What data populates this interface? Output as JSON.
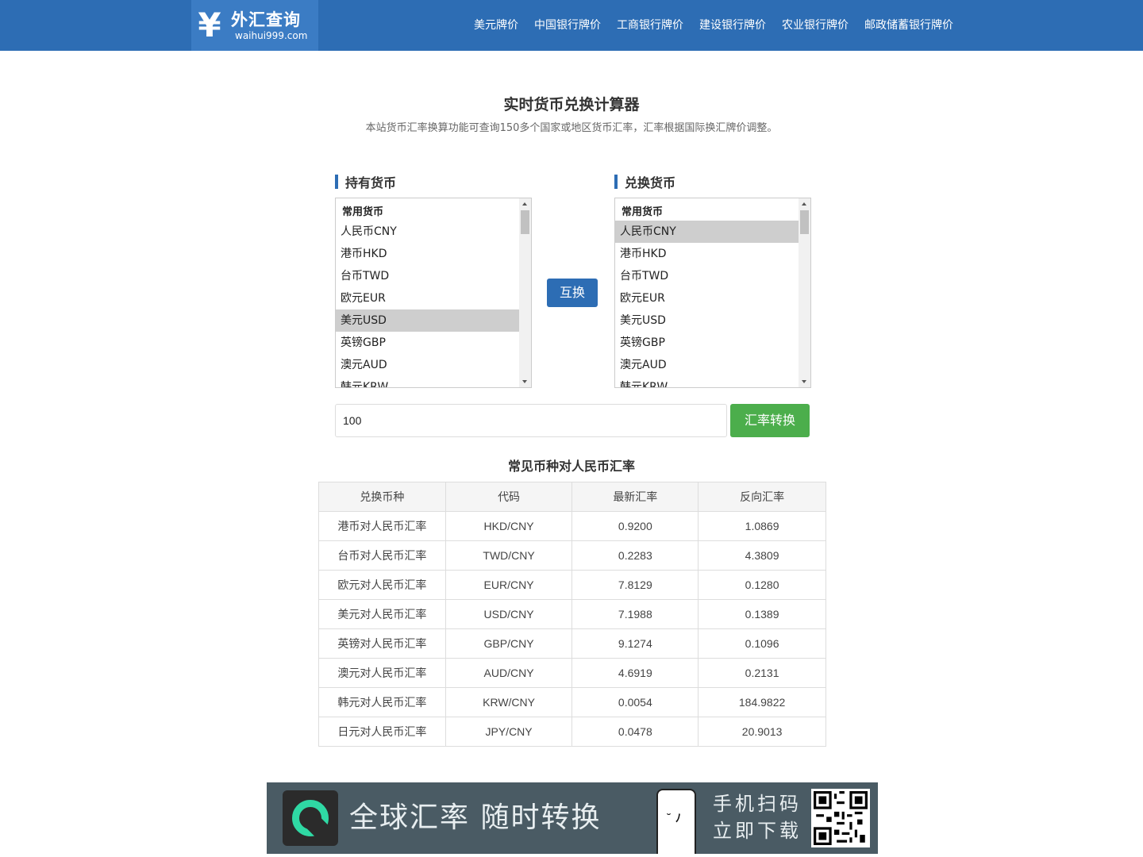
{
  "header": {
    "logo_name": "外汇查询",
    "logo_domain": "waihui999.com",
    "nav": [
      "美元牌价",
      "中国银行牌价",
      "工商银行牌价",
      "建设银行牌价",
      "农业银行牌价",
      "邮政储蓄银行牌价"
    ]
  },
  "main": {
    "title": "实时货币兑换计算器",
    "subtitle": "本站货币汇率换算功能可查询150多个国家或地区货币汇率，汇率根据国际换汇牌价调整。"
  },
  "converter": {
    "from_label": "持有货币",
    "to_label": "兑换货币",
    "group_label": "常用货币",
    "options": [
      "人民币CNY",
      "港币HKD",
      "台币TWD",
      "欧元EUR",
      "美元USD",
      "英镑GBP",
      "澳元AUD",
      "韩元KRW"
    ],
    "from_selected": "美元USD",
    "to_selected": "人民币CNY",
    "swap_label": "互换",
    "amount_value": "100",
    "convert_label": "汇率转换"
  },
  "rates_table": {
    "title": "常见币种对人民币汇率",
    "headers": [
      "兑换币种",
      "代码",
      "最新汇率",
      "反向汇率"
    ],
    "rows": [
      [
        "港币对人民币汇率",
        "HKD/CNY",
        "0.9200",
        "1.0869"
      ],
      [
        "台币对人民币汇率",
        "TWD/CNY",
        "0.2283",
        "4.3809"
      ],
      [
        "欧元对人民币汇率",
        "EUR/CNY",
        "7.8129",
        "0.1280"
      ],
      [
        "美元对人民币汇率",
        "USD/CNY",
        "7.1988",
        "0.1389"
      ],
      [
        "英镑对人民币汇率",
        "GBP/CNY",
        "9.1274",
        "0.1096"
      ],
      [
        "澳元对人民币汇率",
        "AUD/CNY",
        "4.6919",
        "0.2131"
      ],
      [
        "韩元对人民币汇率",
        "KRW/CNY",
        "0.0054",
        "184.9822"
      ],
      [
        "日元对人民币汇率",
        "JPY/CNY",
        "0.0478",
        "20.9013"
      ]
    ]
  },
  "banner": {
    "slogan": "全球汇率 随时转换",
    "scan_line1": "手机扫码",
    "scan_line2": "立即下载",
    "app_icon": "refresh-icon",
    "qr_icon": "qr-code-icon"
  },
  "colors": {
    "header_bg": "#2d6db4",
    "swap_button": "#2d6db4",
    "convert_button": "#4cae4c",
    "banner_bg": "#4a5b64",
    "app_icon_accent": "#2fd9a4"
  }
}
